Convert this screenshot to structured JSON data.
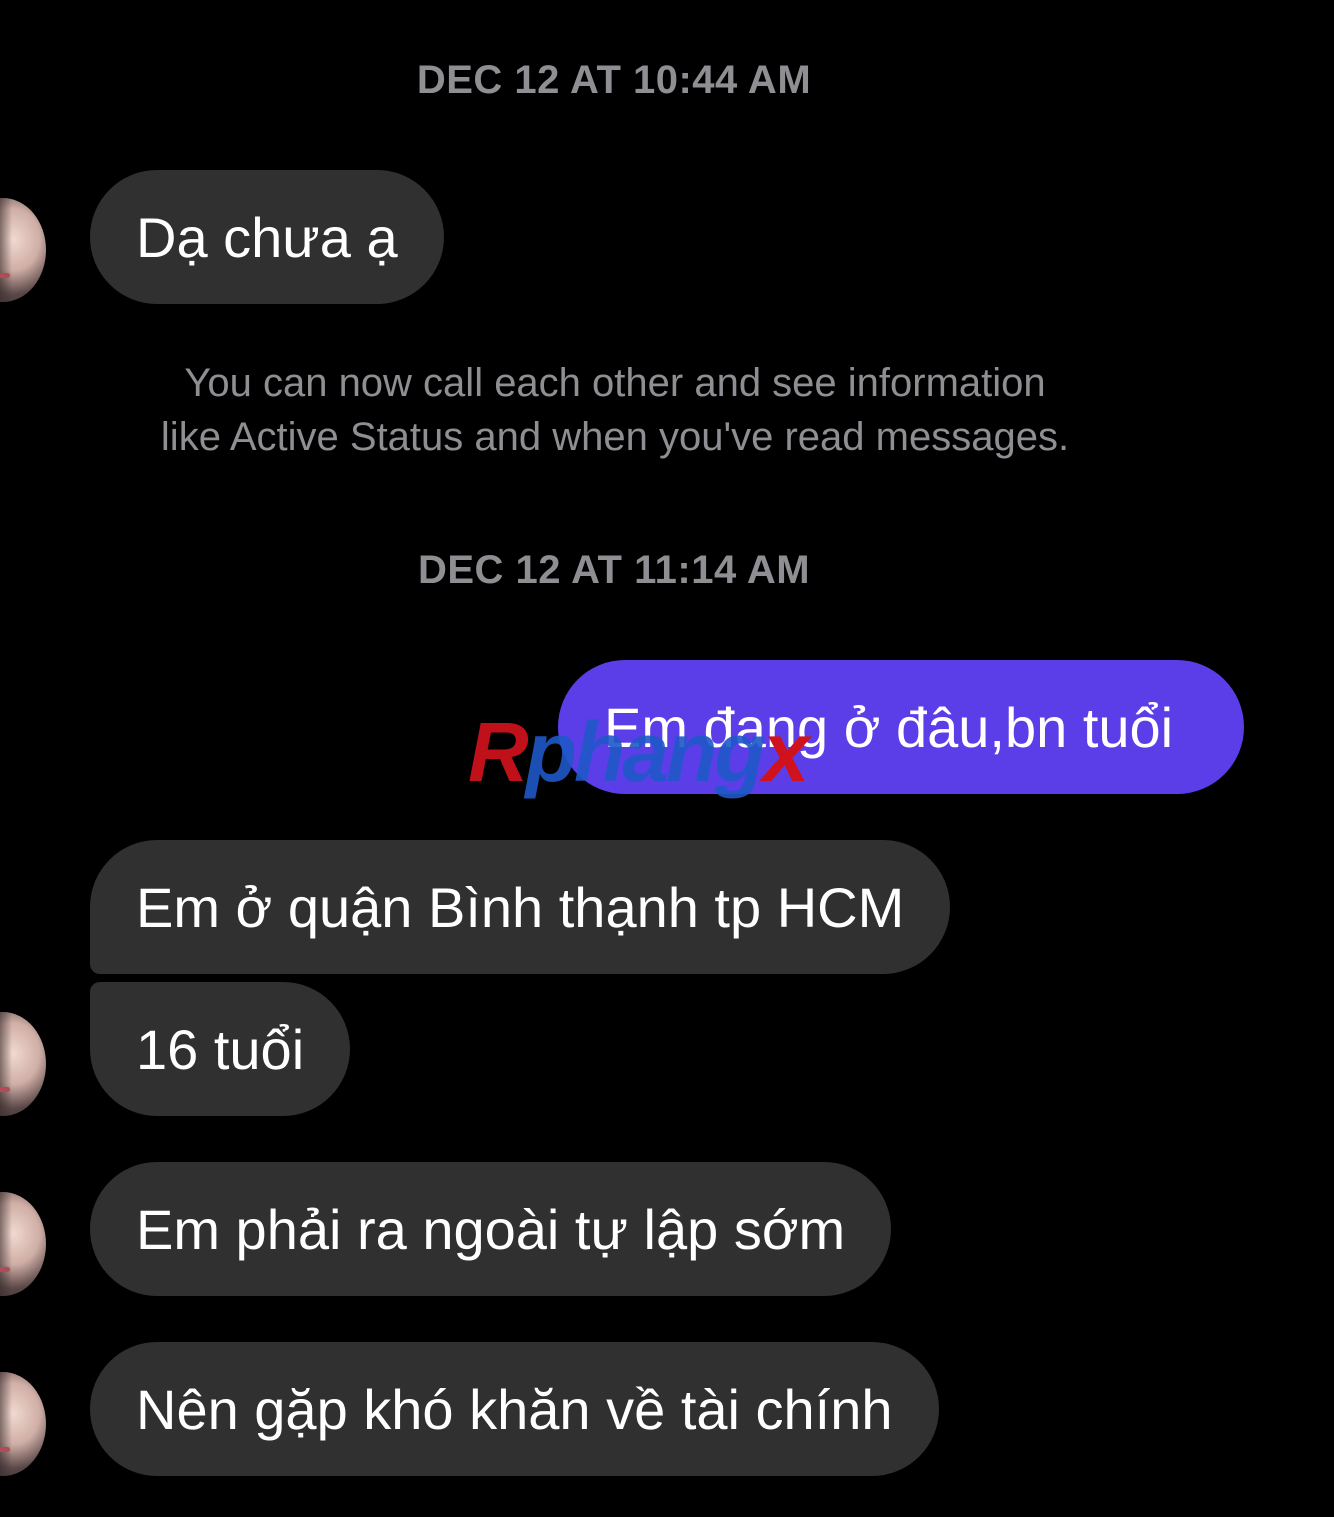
{
  "thread": {
    "timestamp_1": "DEC 12 AT 10:44 AM",
    "message_1": "Dạ chưa ạ",
    "notice_line_1": "You can now call each other and see information",
    "notice_line_2": "like Active Status and when you've read messages.",
    "timestamp_2": "DEC 12 AT 11:14 AM",
    "message_2": "Em đang ở đâu,bn tuổi",
    "message_3": "Em ở quận Bình thạnh tp HCM",
    "message_4": "16 tuổi",
    "message_5": "Em phải ra ngoài tự lập sớm",
    "message_6": "Nên gặp khó khăn về tài chính"
  },
  "watermark": {
    "part_1": "R",
    "part_2": "phang",
    "part_3": "x"
  },
  "colors": {
    "background": "#000000",
    "incoming_bubble": "#303030",
    "outgoing_bubble": "#5b3ee8",
    "meta_text": "#8e8e93"
  }
}
